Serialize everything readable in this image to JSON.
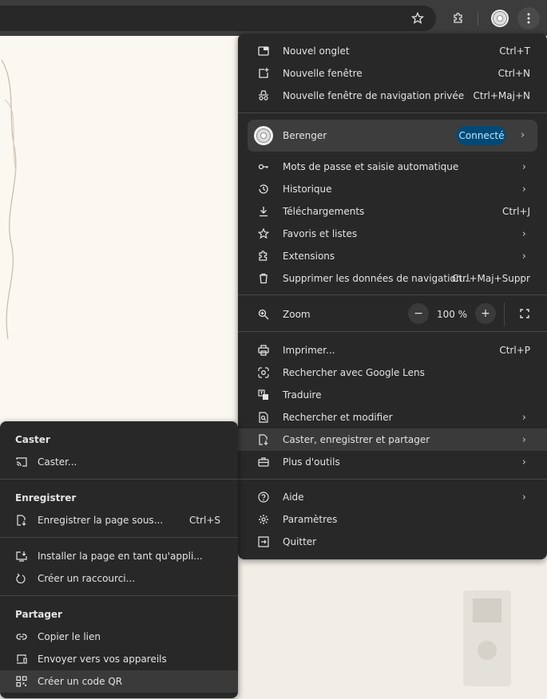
{
  "toolbar": {
    "icons": [
      "star-icon",
      "extensions-icon",
      "profile-avatar",
      "more-vert-icon"
    ]
  },
  "menu": {
    "new_tab": {
      "label": "Nouvel onglet",
      "shortcut": "Ctrl+T"
    },
    "new_window": {
      "label": "Nouvelle fenêtre",
      "shortcut": "Ctrl+N"
    },
    "incognito": {
      "label": "Nouvelle fenêtre de navigation privée",
      "shortcut": "Ctrl+Maj+N"
    },
    "profile": {
      "name": "Berenger",
      "status": "Connecté"
    },
    "passwords": {
      "label": "Mots de passe et saisie automatique"
    },
    "history": {
      "label": "Historique"
    },
    "downloads": {
      "label": "Téléchargements",
      "shortcut": "Ctrl+J"
    },
    "bookmarks": {
      "label": "Favoris et listes"
    },
    "extensions": {
      "label": "Extensions"
    },
    "clear_data": {
      "label": "Supprimer les données de navigation...",
      "shortcut": "Ctrl+Maj+Suppr"
    },
    "zoom": {
      "label": "Zoom",
      "value": "100 %",
      "minus": "−",
      "plus": "+"
    },
    "print": {
      "label": "Imprimer...",
      "shortcut": "Ctrl+P"
    },
    "lens": {
      "label": "Rechercher avec Google Lens"
    },
    "translate": {
      "label": "Traduire"
    },
    "find_edit": {
      "label": "Rechercher et modifier"
    },
    "cast_save_share": {
      "label": "Caster, enregistrer et partager"
    },
    "more_tools": {
      "label": "Plus d'outils"
    },
    "help": {
      "label": "Aide"
    },
    "settings": {
      "label": "Paramètres"
    },
    "quit": {
      "label": "Quitter"
    }
  },
  "submenu": {
    "cast_header": "Caster",
    "cast": {
      "label": "Caster..."
    },
    "save_header": "Enregistrer",
    "save_page": {
      "label": "Enregistrer la page sous...",
      "shortcut": "Ctrl+S"
    },
    "install_app": {
      "label": "Installer la page en tant qu'appli..."
    },
    "create_shortcut": {
      "label": "Créer un raccourci..."
    },
    "share_header": "Partager",
    "copy_link": {
      "label": "Copier le lien"
    },
    "send_devices": {
      "label": "Envoyer vers vos appareils"
    },
    "qr_code": {
      "label": "Créer un code QR"
    }
  }
}
